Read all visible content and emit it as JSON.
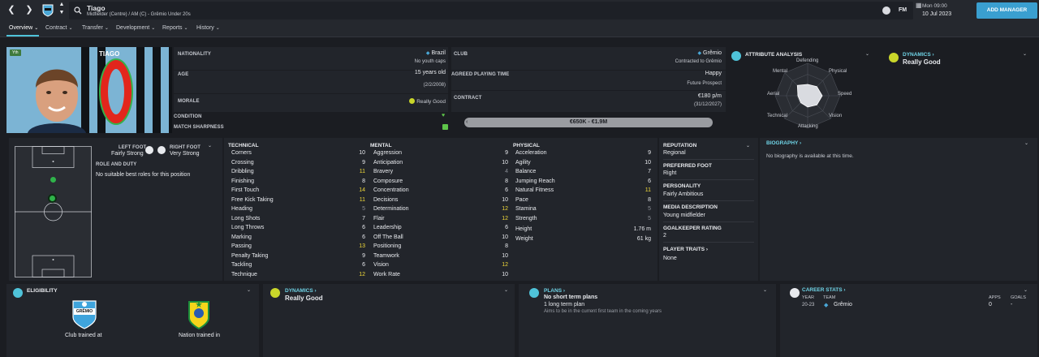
{
  "header": {
    "player_name": "Tiago",
    "subtitle": "Midfielder (Centre) / AM (C) - Grêmio Under 20s",
    "fm_label": "FM",
    "time": "Mon 09:00",
    "date": "10 Jul 2023",
    "add_manager": "ADD MANAGER"
  },
  "tabs": [
    {
      "label": "Overview"
    },
    {
      "label": "Contract"
    },
    {
      "label": "Transfer"
    },
    {
      "label": "Development"
    },
    {
      "label": "Reports"
    },
    {
      "label": "History"
    }
  ],
  "profile": {
    "badge": "Yth",
    "shirt_name": "TIAGO",
    "shirt_number": "0",
    "nationality_label": "NATIONALITY",
    "nationality": "Brazil",
    "youth_caps": "No youth caps",
    "age_label": "AGE",
    "age": "15 years old",
    "dob": "(2/2/2008)",
    "morale_label": "MORALE",
    "morale": "Really Good",
    "condition_label": "CONDITION",
    "sharpness_label": "MATCH SHARPNESS",
    "club_label": "CLUB",
    "club": "Grêmio",
    "club_status": "Contracted to Grêmio",
    "playing_time_label": "AGREED PLAYING TIME",
    "playing_mood": "Happy",
    "playing_time": "Future Prospect",
    "contract_label": "CONTRACT",
    "wage": "€180 p/m",
    "contract_end": "(31/12/2027)",
    "value_range": "€650K - €1.9M"
  },
  "attribute_analysis": {
    "title": "ATTRIBUTE ANALYSIS",
    "axes": [
      "Defending",
      "Physical",
      "Speed",
      "Vision",
      "Attacking",
      "Technical",
      "Aerial",
      "Mental"
    ],
    "values": [
      0.35,
      0.4,
      0.45,
      0.4,
      0.35,
      0.3,
      0.3,
      0.45
    ]
  },
  "dynamics_top": {
    "title": "DYNAMICS",
    "value": "Really Good"
  },
  "positions": {
    "left_foot_label": "LEFT FOOT",
    "left_foot": "Fairly Strong",
    "right_foot_label": "RIGHT FOOT",
    "right_foot": "Very Strong",
    "role_label": "ROLE AND DUTY",
    "role_text": "No suitable best roles for this position"
  },
  "technical": {
    "header": "TECHNICAL",
    "rows": [
      {
        "name": "Corners",
        "value": "10",
        "color": "normal"
      },
      {
        "name": "Crossing",
        "value": "9",
        "color": "normal"
      },
      {
        "name": "Dribbling",
        "value": "11",
        "color": "yellow"
      },
      {
        "name": "Finishing",
        "value": "8",
        "color": "normal"
      },
      {
        "name": "First Touch",
        "value": "14",
        "color": "yellow"
      },
      {
        "name": "Free Kick Taking",
        "value": "11",
        "color": "yellow"
      },
      {
        "name": "Heading",
        "value": "5",
        "color": "grey"
      },
      {
        "name": "Long Shots",
        "value": "7",
        "color": "normal"
      },
      {
        "name": "Long Throws",
        "value": "6",
        "color": "normal"
      },
      {
        "name": "Marking",
        "value": "6",
        "color": "normal"
      },
      {
        "name": "Passing",
        "value": "13",
        "color": "yellow"
      },
      {
        "name": "Penalty Taking",
        "value": "9",
        "color": "normal"
      },
      {
        "name": "Tackling",
        "value": "6",
        "color": "normal"
      },
      {
        "name": "Technique",
        "value": "12",
        "color": "yellow"
      }
    ]
  },
  "mental": {
    "header": "MENTAL",
    "rows": [
      {
        "name": "Aggression",
        "value": "9",
        "color": "normal"
      },
      {
        "name": "Anticipation",
        "value": "10",
        "color": "normal"
      },
      {
        "name": "Bravery",
        "value": "4",
        "color": "grey"
      },
      {
        "name": "Composure",
        "value": "8",
        "color": "normal"
      },
      {
        "name": "Concentration",
        "value": "6",
        "color": "normal"
      },
      {
        "name": "Decisions",
        "value": "10",
        "color": "normal"
      },
      {
        "name": "Determination",
        "value": "12",
        "color": "yellow"
      },
      {
        "name": "Flair",
        "value": "12",
        "color": "yellow"
      },
      {
        "name": "Leadership",
        "value": "6",
        "color": "normal"
      },
      {
        "name": "Off The Ball",
        "value": "10",
        "color": "normal"
      },
      {
        "name": "Positioning",
        "value": "8",
        "color": "normal"
      },
      {
        "name": "Teamwork",
        "value": "10",
        "color": "normal"
      },
      {
        "name": "Vision",
        "value": "12",
        "color": "yellow"
      },
      {
        "name": "Work Rate",
        "value": "10",
        "color": "normal"
      }
    ]
  },
  "physical": {
    "header": "PHYSICAL",
    "rows": [
      {
        "name": "Acceleration",
        "value": "9",
        "color": "normal"
      },
      {
        "name": "Agility",
        "value": "10",
        "color": "normal"
      },
      {
        "name": "Balance",
        "value": "7",
        "color": "normal"
      },
      {
        "name": "Jumping Reach",
        "value": "6",
        "color": "normal"
      },
      {
        "name": "Natural Fitness",
        "value": "11",
        "color": "yellow"
      },
      {
        "name": "Pace",
        "value": "8",
        "color": "normal"
      },
      {
        "name": "Stamina",
        "value": "5",
        "color": "grey"
      },
      {
        "name": "Strength",
        "value": "5",
        "color": "grey"
      }
    ],
    "height_label": "Height",
    "height": "1.76 m",
    "weight_label": "Weight",
    "weight": "61 kg"
  },
  "info": {
    "reputation_label": "REPUTATION",
    "reputation": "Regional",
    "preferred_foot_label": "PREFERRED FOOT",
    "preferred_foot": "Right",
    "personality_label": "PERSONALITY",
    "personality": "Fairly Ambitious",
    "media_label": "MEDIA DESCRIPTION",
    "media": "Young midfielder",
    "gk_label": "GOALKEEPER RATING",
    "gk_rating": "2",
    "traits_label": "PLAYER TRAITS",
    "traits": "None"
  },
  "biography": {
    "title": "BIOGRAPHY",
    "text": "No biography is available at this time."
  },
  "eligibility": {
    "title": "ELIGIBILITY",
    "club_crest": "GRÊMIO",
    "club_label": "Club trained at",
    "nation_label": "Nation trained in"
  },
  "dynamics_bottom": {
    "title": "DYNAMICS",
    "value": "Really Good"
  },
  "plans": {
    "title": "PLANS",
    "short": "No short term plans",
    "long": "1 long term plan",
    "desc": "Aims to be in the current first team in the coming years"
  },
  "career": {
    "title": "CAREER STATS",
    "year_h": "YEAR",
    "team_h": "TEAM",
    "apps_h": "APPS",
    "goals_h": "GOALS",
    "year": "20-23",
    "team": "Grêmio",
    "apps": "0",
    "goals": "-"
  },
  "colors": {
    "accent": "#4fc3d9",
    "yellow": "#f0d93a",
    "bg": "#1b1d22",
    "panel": "#22252b",
    "good": "#9bd12a"
  }
}
